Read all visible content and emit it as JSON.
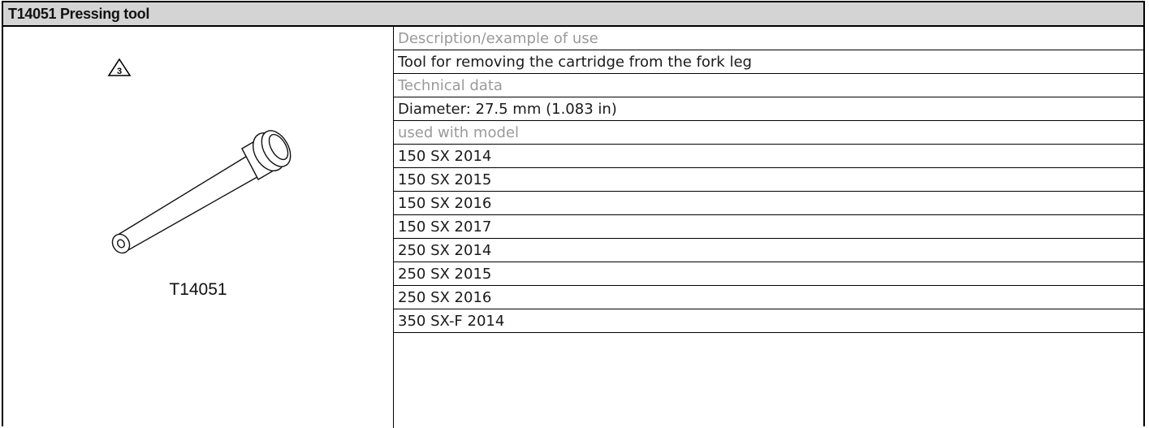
{
  "header": {
    "title": "T14051 Pressing tool"
  },
  "illustration": {
    "icon": "warning-triangle-3-icon",
    "warning_number": "3",
    "part_number": "T14051"
  },
  "details": {
    "description_label": "Description/example of use",
    "description_value": "Tool for removing the cartridge from the fork leg",
    "technical_label": "Technical data",
    "technical_value": "Diameter: 27.5 mm (1.083 in)",
    "models_label": "used with model",
    "models": [
      "150 SX 2014",
      "150 SX 2015",
      "150 SX 2016",
      "150 SX 2017",
      "250 SX 2014",
      "250 SX 2015",
      "250 SX 2016",
      "350 SX-F 2014"
    ]
  }
}
